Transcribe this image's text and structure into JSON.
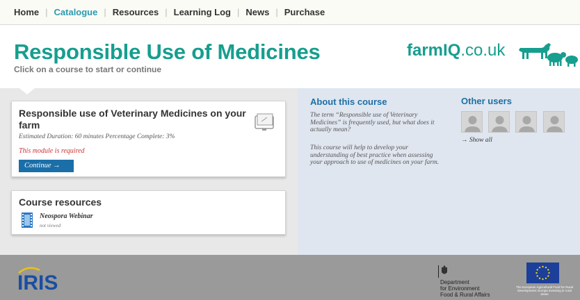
{
  "nav": {
    "items": [
      {
        "label": "Home"
      },
      {
        "label": "Catalogue"
      },
      {
        "label": "Resources"
      },
      {
        "label": "Learning Log"
      },
      {
        "label": "News"
      },
      {
        "label": "Purchase"
      }
    ],
    "active_index": 1
  },
  "header": {
    "title": "Responsible Use of Medicines",
    "subtitle": "Click on a course to start or continue",
    "brand_bold": "farmIQ",
    "brand_rest": ".co.uk"
  },
  "course": {
    "title": "Responsible use of Veterinary Medicines on your farm",
    "meta": "Estimated Duration: 60 minutes Percentage Complete: 3%",
    "required": "This module is required",
    "continue_label": "Continue →",
    "icon": "monitor-icon"
  },
  "resources": {
    "title": "Course resources",
    "items": [
      {
        "name": "Neospora Webinar",
        "status": "not viewed",
        "icon": "film-icon"
      }
    ]
  },
  "about": {
    "title": "About this course",
    "p1": "The term “Responsible use of Veterinary Medicines” is frequently used, but what does it actually mean?",
    "p2": "This course will help to develop your understanding of best practice when assessing your approach to use of medicines on your farm."
  },
  "other_users": {
    "title": "Other users",
    "show_all": "→ Show all",
    "avatar_count": 4
  },
  "footer": {
    "iris_logo": "IRIS",
    "defra_lines": [
      "Department",
      "for Environment",
      "Food & Rural Affairs"
    ],
    "eu_text": "The European Agricultural Fund for Rural Development: Europe investing in rural areas"
  },
  "colors": {
    "accent": "#169e8f",
    "nav_active": "#2a9ab0",
    "link_blue": "#1d6fa5",
    "button": "#1a6fa8",
    "required": "#cc3333"
  }
}
